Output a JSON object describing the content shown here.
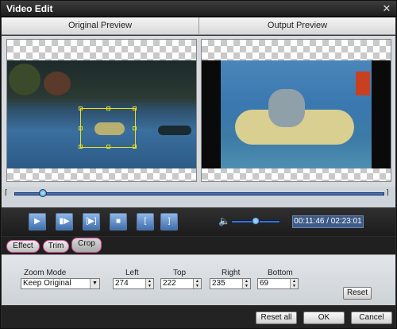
{
  "window": {
    "title": "Video Edit",
    "close_glyph": "✕"
  },
  "preview": {
    "original_label": "Original Preview",
    "output_label": "Output Preview"
  },
  "timeline": {
    "position_fraction": 0.08
  },
  "transport": {
    "buttons": [
      {
        "name": "play-button",
        "glyph": "▶"
      },
      {
        "name": "next-frame-button",
        "glyph": "▮▶"
      },
      {
        "name": "snapshot-button",
        "glyph": "[▶]"
      },
      {
        "name": "stop-button",
        "glyph": "■"
      },
      {
        "name": "mark-in-button",
        "glyph": "["
      },
      {
        "name": "mark-out-button",
        "glyph": "]"
      }
    ],
    "volume_icon": "speaker-icon",
    "volume_fraction": 0.45,
    "timecode": "00:11:46 / 02:23:01"
  },
  "tabs": [
    {
      "label": "Effect",
      "active": false
    },
    {
      "label": "Trim",
      "active": false
    },
    {
      "label": "Crop",
      "active": true
    }
  ],
  "crop": {
    "zoom_mode_label": "Zoom Mode",
    "zoom_mode_value": "Keep Original",
    "left_label": "Left",
    "left_value": "274",
    "top_label": "Top",
    "top_value": "222",
    "right_label": "Right",
    "right_value": "235",
    "bottom_label": "Bottom",
    "bottom_value": "69",
    "reset_label": "Reset"
  },
  "footer": {
    "reset_all_label": "Reset all",
    "ok_label": "OK",
    "cancel_label": "Cancel"
  },
  "colors": {
    "accent": "#3a6fd6",
    "tab_outline": "#e24a9a",
    "selection": "#e8e020"
  }
}
